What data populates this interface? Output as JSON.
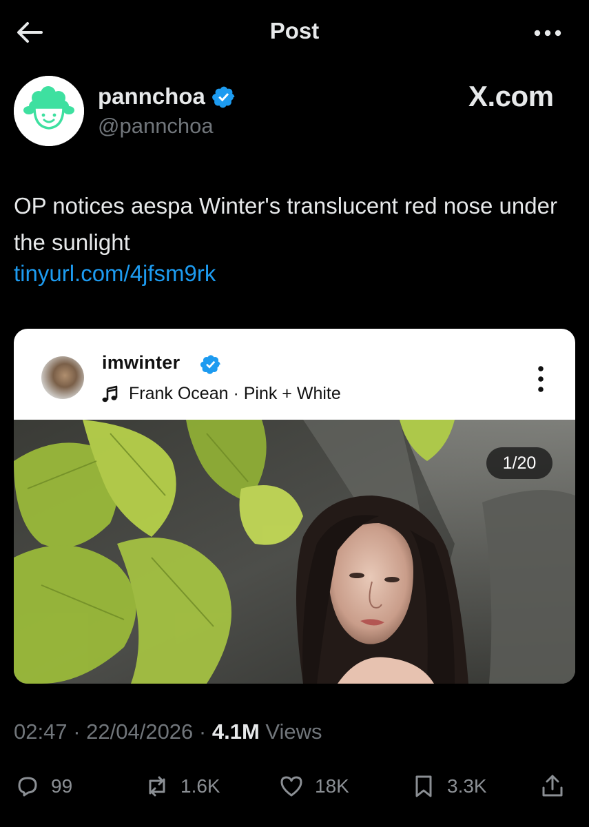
{
  "header": {
    "title": "Post"
  },
  "author": {
    "name": "pannchoa",
    "handle": "@pannchoa",
    "watermark": "X.com"
  },
  "post": {
    "text": "OP notices aespa Winter's translucent red nose under the sunlight",
    "link": "tinyurl.com/4jfsm9rk"
  },
  "embed": {
    "username": "imwinter",
    "music": "Frank Ocean · Pink + White",
    "counter": "1/20"
  },
  "meta": {
    "time": "02:47",
    "date": "22/04/2026",
    "views_count": "4.1M",
    "views_label": "Views"
  },
  "actions": {
    "replies": "99",
    "reposts": "1.6K",
    "likes": "18K",
    "bookmarks": "3.3K"
  },
  "colors": {
    "background": "#000000",
    "text_primary": "#e7e9ea",
    "text_secondary": "#71767b",
    "link": "#1d9bf0",
    "verified": "#1d9bf0"
  },
  "icons": [
    "back-arrow-icon",
    "more-horizontal-icon",
    "verified-badge-icon",
    "music-note-icon",
    "more-vertical-icon",
    "reply-icon",
    "repost-icon",
    "like-icon",
    "bookmark-icon",
    "share-icon"
  ]
}
